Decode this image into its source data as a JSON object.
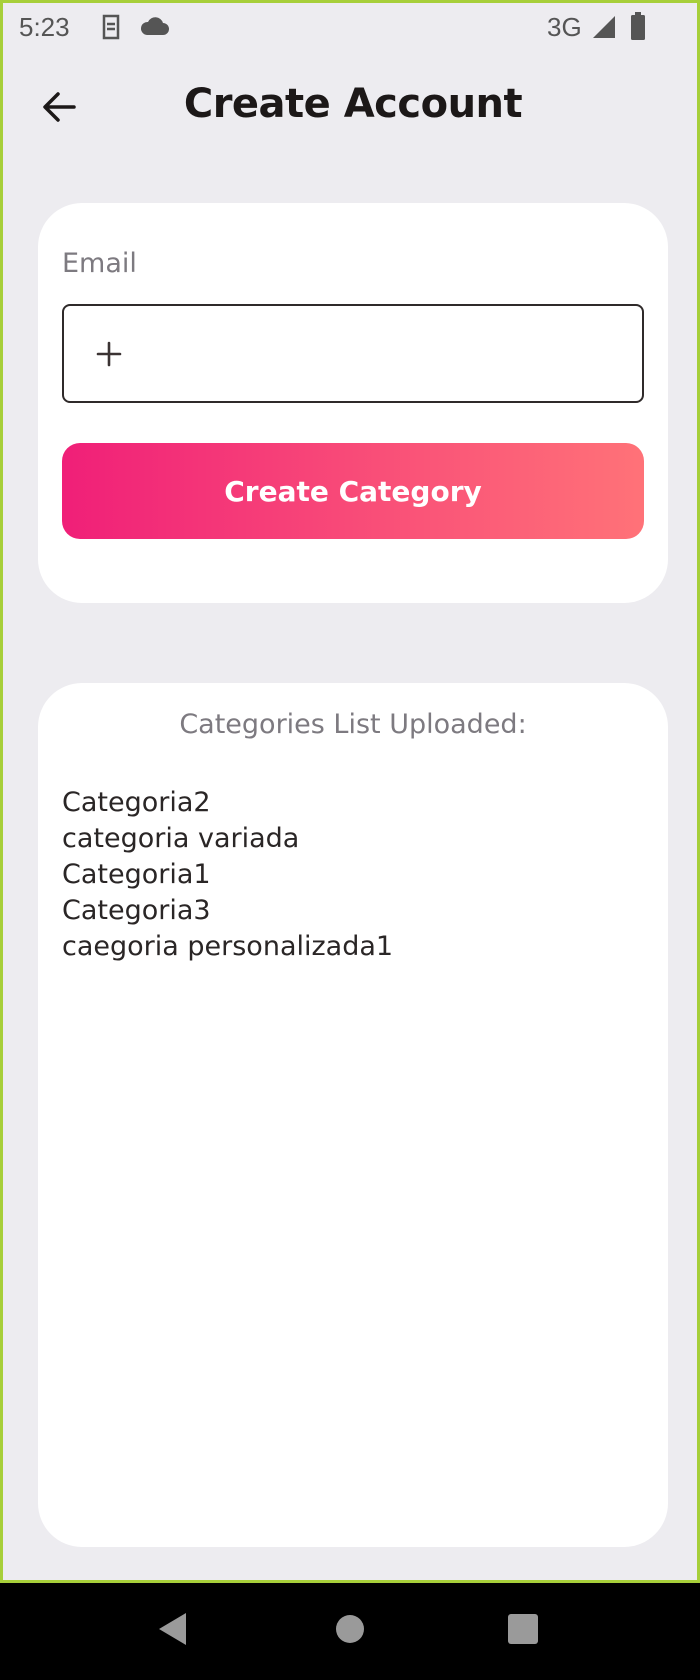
{
  "status_bar": {
    "time": "5:23",
    "network": "3G",
    "icons": [
      "sim-card-icon",
      "cloud-icon",
      "signal-icon",
      "battery-icon"
    ]
  },
  "app_bar": {
    "title": "Create Account",
    "back_icon": "arrow-back-icon"
  },
  "form": {
    "email_label": "Email",
    "email_value": "",
    "input_icon": "plus-icon",
    "create_button_label": "Create Category"
  },
  "categories": {
    "title": "Categories List Uploaded:",
    "items": [
      "Categoria2",
      "categoria variada",
      "Categoria1",
      "Categoria3",
      "caegoria personalizada1"
    ]
  },
  "nav_bar": {
    "icons": [
      "back-triangle-icon",
      "home-circle-icon",
      "recents-square-icon"
    ]
  },
  "colors": {
    "background": "#edecf0",
    "button_gradient_start": "#f01f78",
    "button_gradient_end": "#ff7278",
    "frame_border": "#a7cf3a"
  }
}
